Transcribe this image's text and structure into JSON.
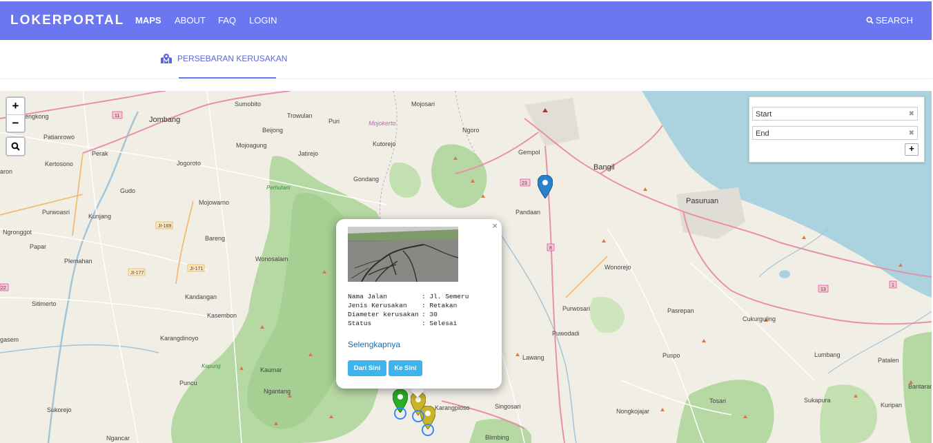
{
  "navbar": {
    "brand": "LOKERPORTAL",
    "items": [
      {
        "label": "MAPS",
        "active": true
      },
      {
        "label": "ABOUT",
        "active": false
      },
      {
        "label": "FAQ",
        "active": false
      },
      {
        "label": "LOGIN",
        "active": false
      }
    ],
    "search_label": "SEARCH"
  },
  "tabs": {
    "active_label": "PERSEBARAN KERUSAKAN",
    "icon": "map-marked-icon"
  },
  "map_controls": {
    "zoom_in": "+",
    "zoom_out": "−",
    "search_icon": "search-icon"
  },
  "routing": {
    "start_placeholder": "Start",
    "end_placeholder": "End",
    "add_label": "+"
  },
  "popup": {
    "fields": [
      {
        "key": "Nama Jalan",
        "value": ": Jl. Semeru"
      },
      {
        "key": "Jenis Kerusakan",
        "value": ": Retakan"
      },
      {
        "key": "Diameter kerusakan",
        "value": ": 30"
      },
      {
        "key": "Status",
        "value": ": Selesai"
      }
    ],
    "more_link": "Selengkapnya",
    "from_here": "Dari Sini",
    "to_here": "Ke Sini"
  },
  "places": {
    "jombang": "Jombang",
    "sumobito": "Sumobito",
    "mojosari": "Mojosari",
    "trowulan": "Trowulan",
    "puri": "Puri",
    "mojokerto": "Mojokerto",
    "ngoro": "Ngoro",
    "gempol": "Gempol",
    "bangil": "Bangil",
    "pasuruan": "Pasuruan",
    "pandaan": "Pandaan",
    "wonorejo": "Wonorejo",
    "purwosari": "Purwosari",
    "pasrepan": "Pasrepan",
    "cukurguling": "Cukurguling",
    "puwodadi": "Puwodadi",
    "lawang": "Lawang",
    "puspo": "Puspo",
    "lumbang": "Lumbang",
    "patalen": "Patalen",
    "sukapura": "Sukapura",
    "tosari": "Tosari",
    "nongkojajar": "Nongkojajar",
    "singosari": "Singosari",
    "karangploso": "Karangploso",
    "kutorejo": "Kutorejo",
    "jatirejo": "Jatirejo",
    "gondang": "Gondang",
    "bareng": "Bareng",
    "wonosalam": "Wonosalam",
    "mojowarno": "Mojowarno",
    "jogoroto": "Jogoroto",
    "gudo": "Gudo",
    "kertosono": "Kertosono",
    "perak": "Perak",
    "patianrowo": "Patianrowo",
    "purwoasri": "Purwoasri",
    "kunjang": "Kunjang",
    "ngronggot": "Ngronggot",
    "papar": "Papar",
    "plemahan": "Plemahan",
    "sitimerto": "Sitimerto",
    "kandangan": "Kandangan",
    "kasembon": "Kasembon",
    "karangdinoyo": "Karangdinoyo",
    "kaumar": "Kaumar",
    "ngantang": "Ngantang",
    "puncu": "Puncu",
    "sukorejo": "Sukorejo",
    "ngancar": "Ngancar",
    "beijong": "Beijong",
    "mojoagung": "Mojoagung",
    "blimbing": "Blimbing",
    "kurpan": "Kuripan",
    "bantaran": "Bantaran",
    "gengkong": "engkong",
    "aron": "aron",
    "gasem": "gasem",
    "perhutani": "Perhutani",
    "kepung": "Kepung"
  }
}
